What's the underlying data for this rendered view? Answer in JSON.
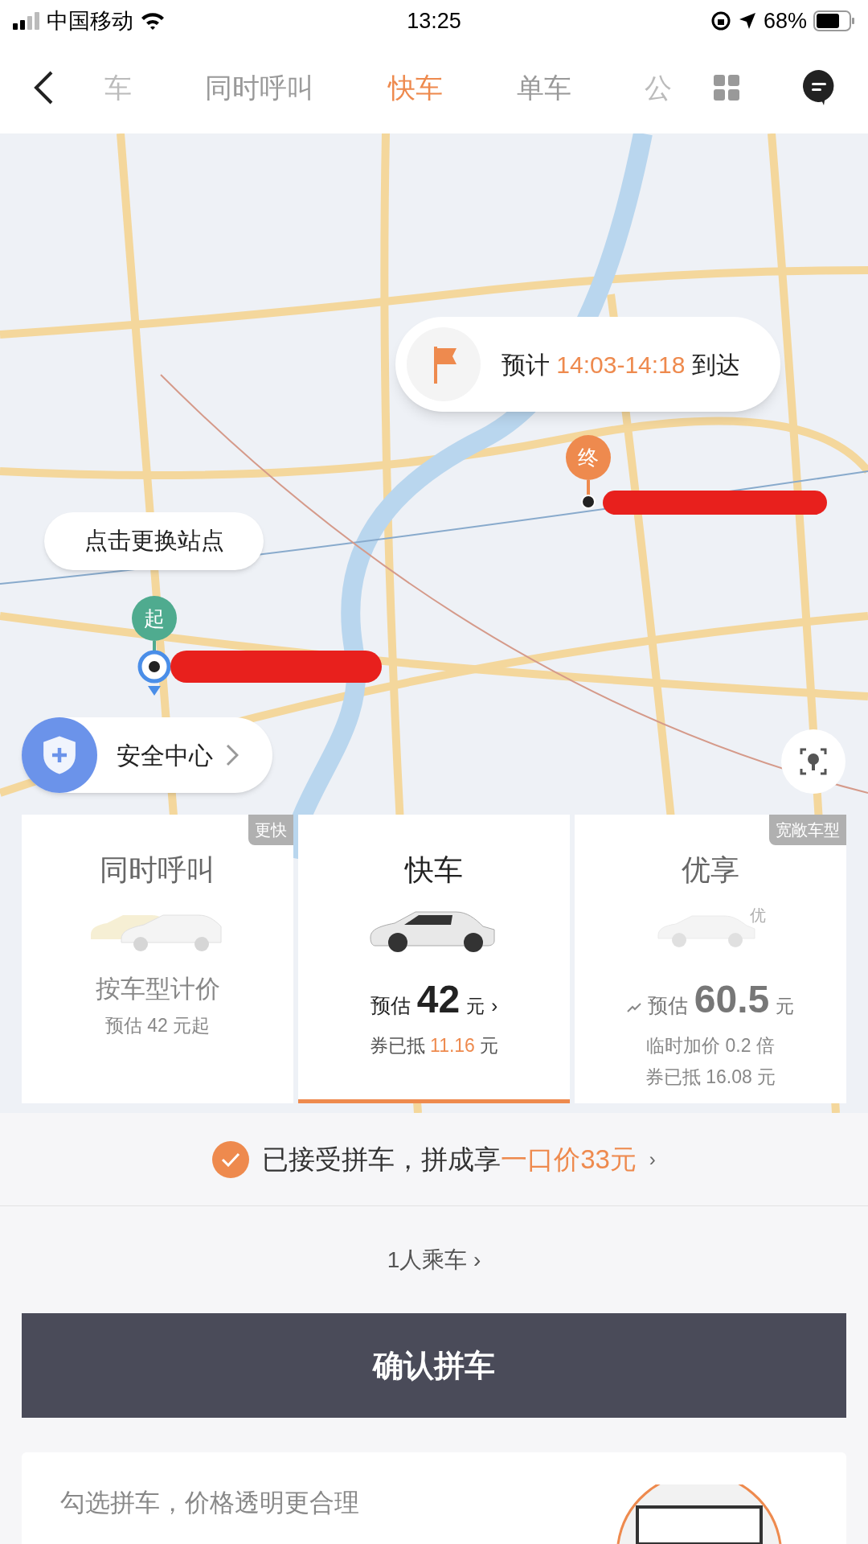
{
  "status_bar": {
    "carrier": "中国移动",
    "time": "13:25",
    "battery": "68%"
  },
  "tabs": [
    {
      "label": "车",
      "selected": false,
      "cut": true
    },
    {
      "label": "同时呼叫",
      "selected": false
    },
    {
      "label": "快车",
      "selected": true
    },
    {
      "label": "单车",
      "selected": false
    },
    {
      "label": "公",
      "selected": false,
      "cut": true
    }
  ],
  "eta": {
    "label": "预计",
    "time": "14:03-14:18",
    "suffix": "到达"
  },
  "start_pin": "起",
  "end_pin": "终",
  "change_stop_tip": "点击更换站点",
  "safety_center": "安全中心",
  "cards": [
    {
      "title": "同时呼叫",
      "tag": "更快",
      "selected": false,
      "kind": "double",
      "lines": [
        {
          "kind": "plain",
          "text": "按车型计价",
          "large": true
        },
        {
          "kind": "plain",
          "text": "预估 42 元起",
          "large": false
        }
      ]
    },
    {
      "title": "快车",
      "selected": true,
      "kind": "single",
      "price": {
        "label": "预估",
        "amount": "42",
        "unit": "元",
        "chevron": "›",
        "surge": false
      },
      "lines": [
        {
          "kind": "discount",
          "label": "券已抵",
          "amount": "11.16",
          "unit": "元"
        }
      ]
    },
    {
      "title": "优享",
      "tag": "宽敞车型",
      "selected": false,
      "kind": "premium",
      "car_badge": "优",
      "price": {
        "label": "预估",
        "amount": "60.5",
        "unit": "元",
        "surge": true
      },
      "lines": [
        {
          "kind": "plain",
          "text": "临时加价 0.2 倍",
          "large": false
        },
        {
          "kind": "plain",
          "text": "券已抵 16.08 元",
          "large": false
        }
      ]
    }
  ],
  "carpool": {
    "checked": true,
    "text": "已接受拼车，拼成享",
    "highlight": "一口价33元",
    "chevron": "›"
  },
  "passengers": {
    "text": "1人乘车",
    "chevron": "›"
  },
  "confirm_button": "确认拼车",
  "promo": {
    "text": "勾选拼车，价格透明更合理"
  }
}
